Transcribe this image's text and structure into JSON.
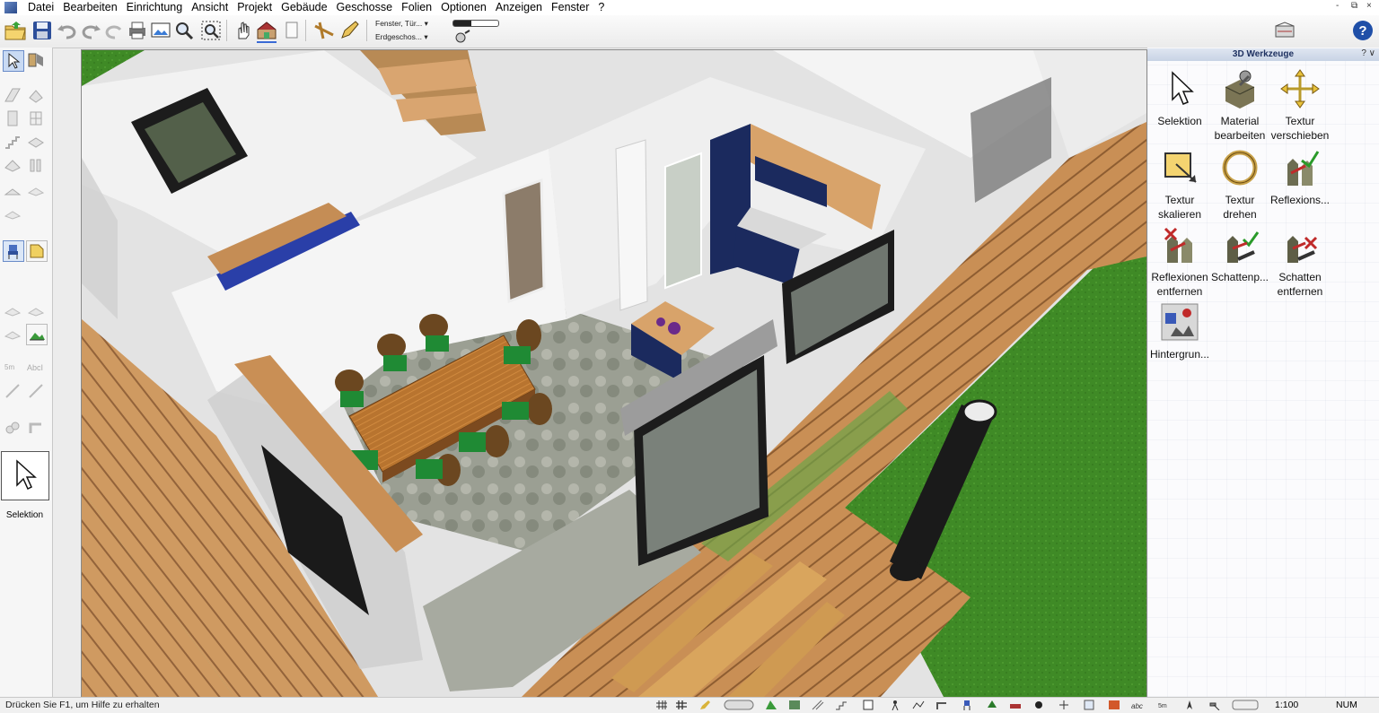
{
  "menu": {
    "items": [
      "Datei",
      "Bearbeiten",
      "Einrichtung",
      "Ansicht",
      "Projekt",
      "Gebäude",
      "Geschosse",
      "Folien",
      "Optionen",
      "Anzeigen",
      "Fenster",
      "?"
    ]
  },
  "window_controls": {
    "minimize": "-",
    "restore": "⧉",
    "close": "×"
  },
  "toolbar": {
    "layer_filter": "Fenster, Tür...",
    "floor_select": "Erdgeschos...",
    "dropdown_arrow": "▾"
  },
  "left_panel": {
    "active_tool_label": "Selektion"
  },
  "right_panel": {
    "title": "3D Werkzeuge",
    "help_glyph": "?",
    "collapse_glyph": "∨",
    "tools": [
      {
        "label_l1": "Selektion",
        "label_l2": ""
      },
      {
        "label_l1": "Material",
        "label_l2": "bearbeiten"
      },
      {
        "label_l1": "Textur",
        "label_l2": "verschieben"
      },
      {
        "label_l1": "Textur",
        "label_l2": "skalieren"
      },
      {
        "label_l1": "Textur",
        "label_l2": "drehen"
      },
      {
        "label_l1": "Reflexions...",
        "label_l2": ""
      },
      {
        "label_l1": "Reflexionen",
        "label_l2": "entfernen"
      },
      {
        "label_l1": "Schattenp...",
        "label_l2": ""
      },
      {
        "label_l1": "Schatten",
        "label_l2": "entfernen"
      },
      {
        "label_l1": "Hintergrun...",
        "label_l2": ""
      }
    ]
  },
  "status": {
    "help_text": "Drücken Sie F1, um Hilfe zu erhalten",
    "scale": "1:100",
    "num": "NUM"
  },
  "colors": {
    "grass": "#3f8a26",
    "deck": "#c98f55",
    "wall": "#f4f4f4",
    "floor": "#9a9e90",
    "chair_seat": "#1f8a34",
    "cabinet": "#1b2a5e",
    "table": "#b8742f"
  }
}
